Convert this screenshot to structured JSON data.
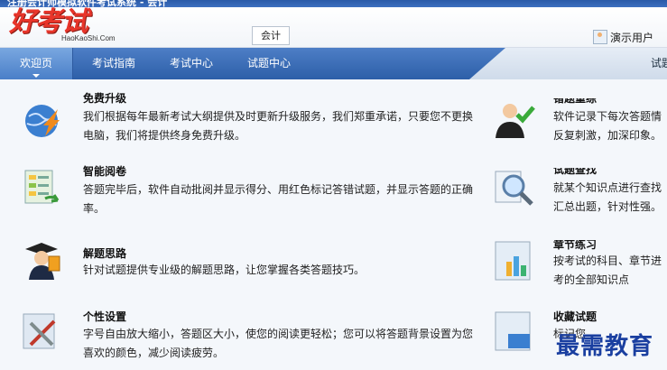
{
  "window": {
    "title": "注册会计师模拟软件考试系统 - 会计"
  },
  "header": {
    "logo_text": "好考试",
    "logo_sub": "HaoKaoShi.Com",
    "subject": "会计",
    "user": "演示用户"
  },
  "nav": {
    "tabs": [
      "欢迎页",
      "考试指南",
      "考试中心",
      "试题中心"
    ],
    "right_tab": "试题"
  },
  "features_left": [
    {
      "title": "免费升级",
      "desc": "我们根据每年最新考试大纲提供及时更新升级服务，我们郑重承诺，只要您不更换电脑，我们将提供终身免费升级。",
      "icon": "globe-upgrade-icon"
    },
    {
      "title": "智能阅卷",
      "desc": "答题完毕后，软件自动批阅并显示得分、用红色标记答错试题，并显示答题的正确率。",
      "icon": "document-check-icon"
    },
    {
      "title": "解题思路",
      "desc": "针对试题提供专业级的解题思路，让您掌握各类答题技巧。",
      "icon": "graduate-icon"
    },
    {
      "title": "个性设置",
      "desc": "字号自由放大缩小，答题区大小，使您的阅读更轻松；您可以将答题背景设置为您喜欢的颜色，减少阅读疲劳。",
      "icon": "tools-icon"
    }
  ],
  "features_right": [
    {
      "title": "错题重练",
      "desc": "软件记录下每次答题情反复刺激，加深印象。",
      "icon": "person-check-icon"
    },
    {
      "title": "试题查找",
      "desc": "就某个知识点进行查找汇总出题，针对性强。",
      "icon": "magnifier-icon"
    },
    {
      "title": "章节练习",
      "desc": "按考试的科目、章节进考的全部知识点",
      "icon": "chart-icon"
    },
    {
      "title": "收藏试题",
      "desc": "标记您",
      "icon": "folder-icon"
    }
  ],
  "watermark": "最需教育"
}
